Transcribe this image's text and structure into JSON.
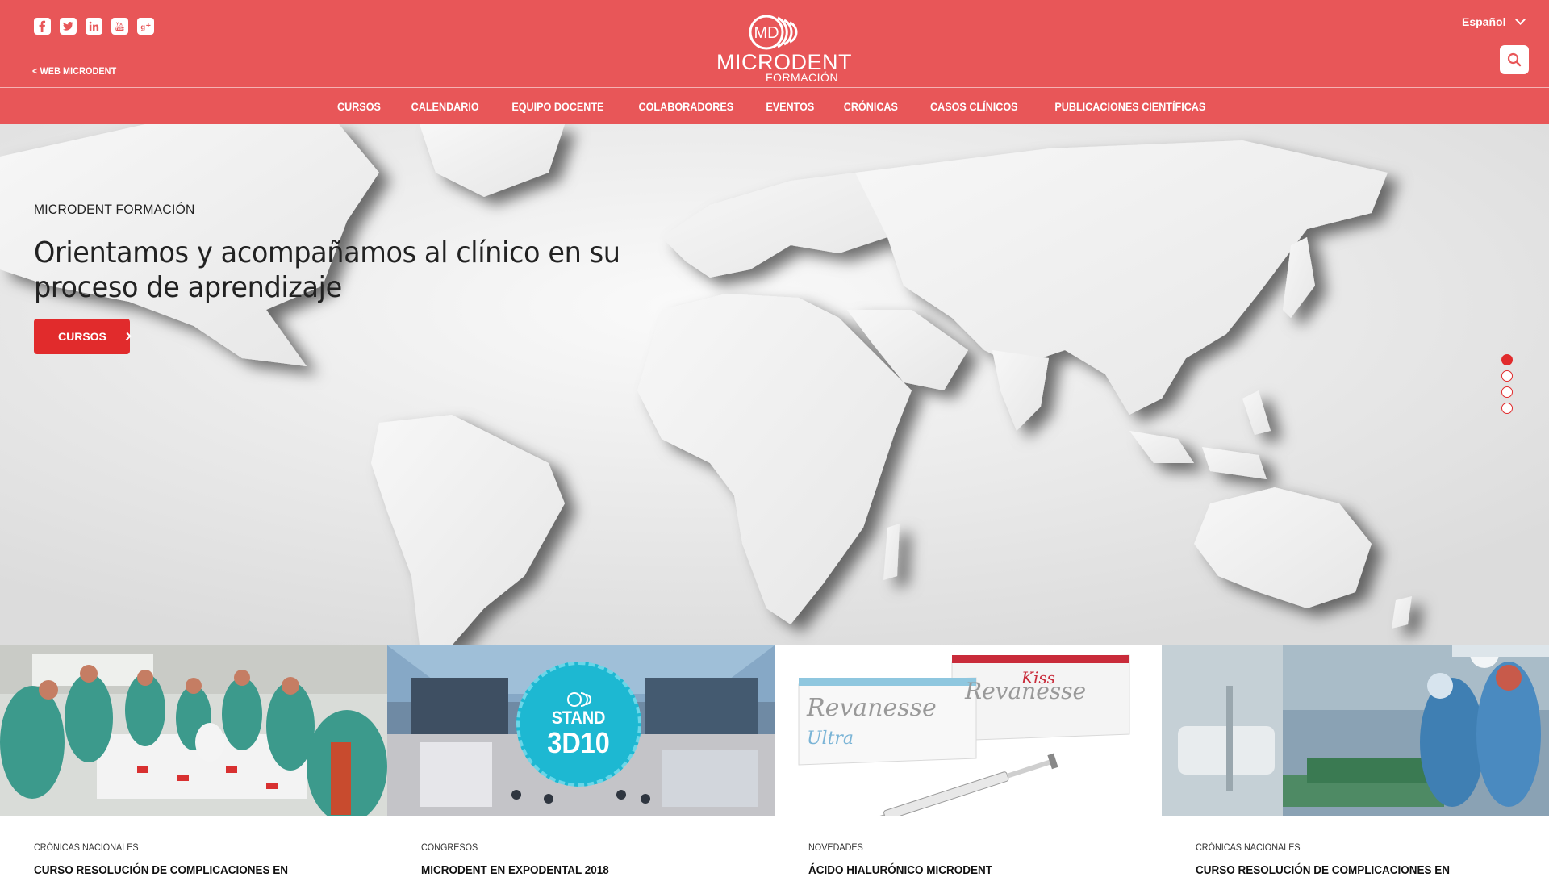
{
  "header": {
    "social": [
      {
        "icon": "facebook-icon"
      },
      {
        "icon": "twitter-icon"
      },
      {
        "icon": "linkedin-icon"
      },
      {
        "icon": "youtube-icon"
      },
      {
        "icon": "google-plus-icon"
      }
    ],
    "back_link": "< WEB MICRODENT",
    "logo": {
      "monogram": "MD",
      "brand": "MICRODENT",
      "sub": "FORMACIÓN"
    },
    "language": "Español",
    "search_icon": "search-icon"
  },
  "nav": {
    "items": [
      "CURSOS",
      "CALENDARIO",
      "EQUIPO DOCENTE",
      "COLABORADORES",
      "EVENTOS",
      "CRÓNICAS",
      "CASOS CLÍNICOS",
      "PUBLICACIONES CIENTÍFICAS"
    ]
  },
  "hero": {
    "eyebrow": "MICRODENT FORMACIÓN",
    "headline": "Orientamos y acompañamos al clínico en su proceso de aprendizaje",
    "cta": "CURSOS",
    "slides": 4,
    "active_slide": 1
  },
  "cards": [
    {
      "category": "CRÓNICAS NACIONALES",
      "title": "CURSO RESOLUCIÓN DE COMPLICACIONES EN"
    },
    {
      "category": "CONGRESOS",
      "title": "MICRODENT EN EXPODENTAL 2018",
      "badge": {
        "line1": "STAND",
        "line2": "3D10"
      }
    },
    {
      "category": "NOVEDADES",
      "title": "ÁCIDO HIALURÓNICO MICRODENT",
      "products": {
        "a": "Revanesse",
        "a_suffix": "Ultra",
        "b": "Revanesse",
        "b_suffix": "Kiss"
      }
    },
    {
      "category": "CRÓNICAS NACIONALES",
      "title": "CURSO RESOLUCIÓN DE COMPLICACIONES EN"
    }
  ],
  "colors": {
    "brand": "#e85658",
    "accent": "#e12b2c",
    "dots": "#e12b2c"
  }
}
